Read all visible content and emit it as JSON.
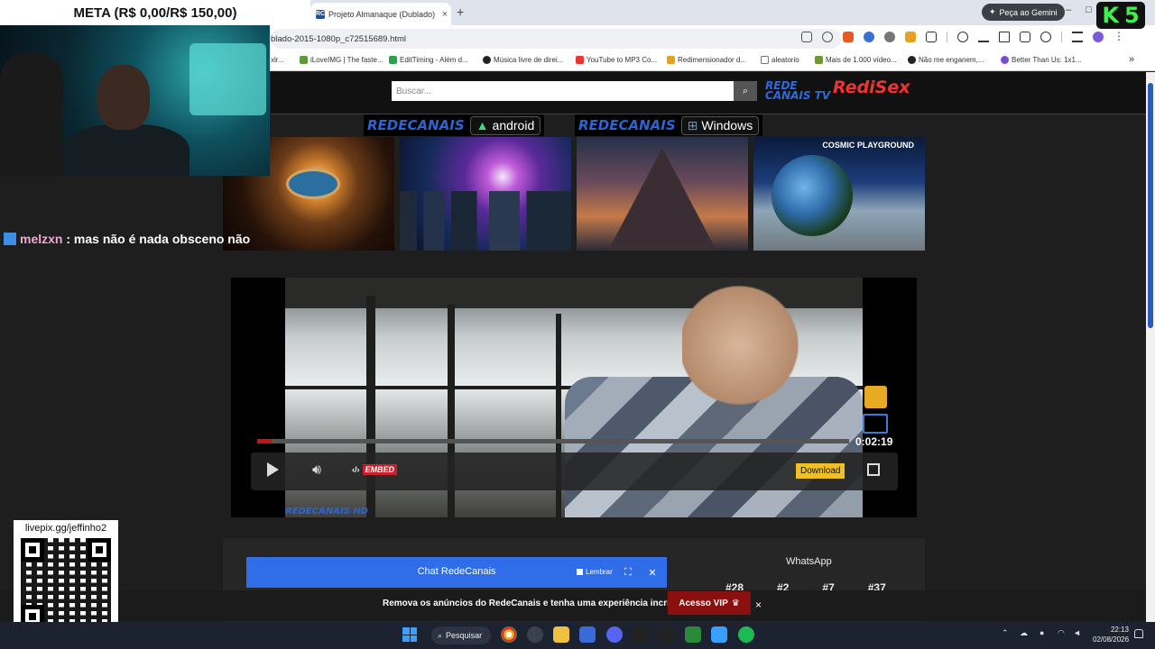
{
  "stream_overlay": {
    "goal_text": "META (R$ 0,00/R$ 150,00)",
    "chat": {
      "username": "melzxn",
      "separator": ":",
      "message": "mas não é nada obsceno não"
    },
    "qr_label": "livepix.gg/jeffinho2",
    "channel_logo": {
      "letter1": "K",
      "letter2": "5"
    }
  },
  "browser": {
    "tab": {
      "title": "Projeto Almanaque (Dublado)",
      "favicon": "RC",
      "close": "×"
    },
    "new_tab": "+",
    "gemini_button": "Peça ao Gemini",
    "window_controls": {
      "minimize": "–",
      "maximize": "□"
    },
    "url": "blado-2015-1080p_c72515689.html",
    "bookmarks": [
      {
        "label": "xlr...",
        "color": "#888888"
      },
      {
        "label": "iLoveIMG | The faste...",
        "color": "#5b9b3a"
      },
      {
        "label": "EditTiming - Além d...",
        "color": "#2aa44a"
      },
      {
        "label": "Música livre de direi...",
        "color": "#222222"
      },
      {
        "label": "YouTube to MP3 Co...",
        "color": "#e33333"
      },
      {
        "label": "Redimensionador d...",
        "color": "#e8a020"
      },
      {
        "label": "aleatorio",
        "color": "#777777"
      },
      {
        "label": "Mais de 1.000 vídeo...",
        "color": "#6a9a2a"
      },
      {
        "label": "Não me enganem,...",
        "color": "#222222"
      },
      {
        "label": "Better Than Us: 1x1...",
        "color": "#7a4ad8"
      }
    ],
    "bookmarks_more": "»"
  },
  "site": {
    "search_placeholder": "Buscar...",
    "logo": {
      "line1": "REDE",
      "line2": "CANAIS TV",
      "red": "RediSex"
    },
    "app_banners": [
      {
        "brand": "REDECANAIS",
        "store": "android",
        "store_top": "PARA"
      },
      {
        "brand": "REDECANAIS",
        "store": "Windows",
        "store_top": "Disponível no"
      }
    ],
    "thumbnails": [
      {
        "id": "eye",
        "label": ""
      },
      {
        "id": "galaxy-city",
        "label": ""
      },
      {
        "id": "mountain",
        "label": ""
      },
      {
        "id": "playground",
        "label": "COSMIC PLAYGROUND"
      }
    ],
    "player": {
      "time": "0:02:19",
      "progress_fraction": 0.024,
      "embed_label": "EMBED",
      "download_label": "Download",
      "watermark": "REDECANAIS HD"
    },
    "chat_widget": {
      "title": "Chat RedeCanais",
      "remember": "Lembrar"
    },
    "whatsapp": "WhatsApp",
    "ranks": [
      "#28",
      "#2",
      "#7",
      "#37"
    ],
    "ad_bar": {
      "text": "Remova os anúncios do RedeCanais e tenha uma experiência incrível!",
      "vip": "Acesso VIP",
      "close": "×"
    }
  },
  "taskbar": {
    "search": "Pesquisar",
    "clock_time": "22:13",
    "clock_date": "02/08/2026"
  }
}
